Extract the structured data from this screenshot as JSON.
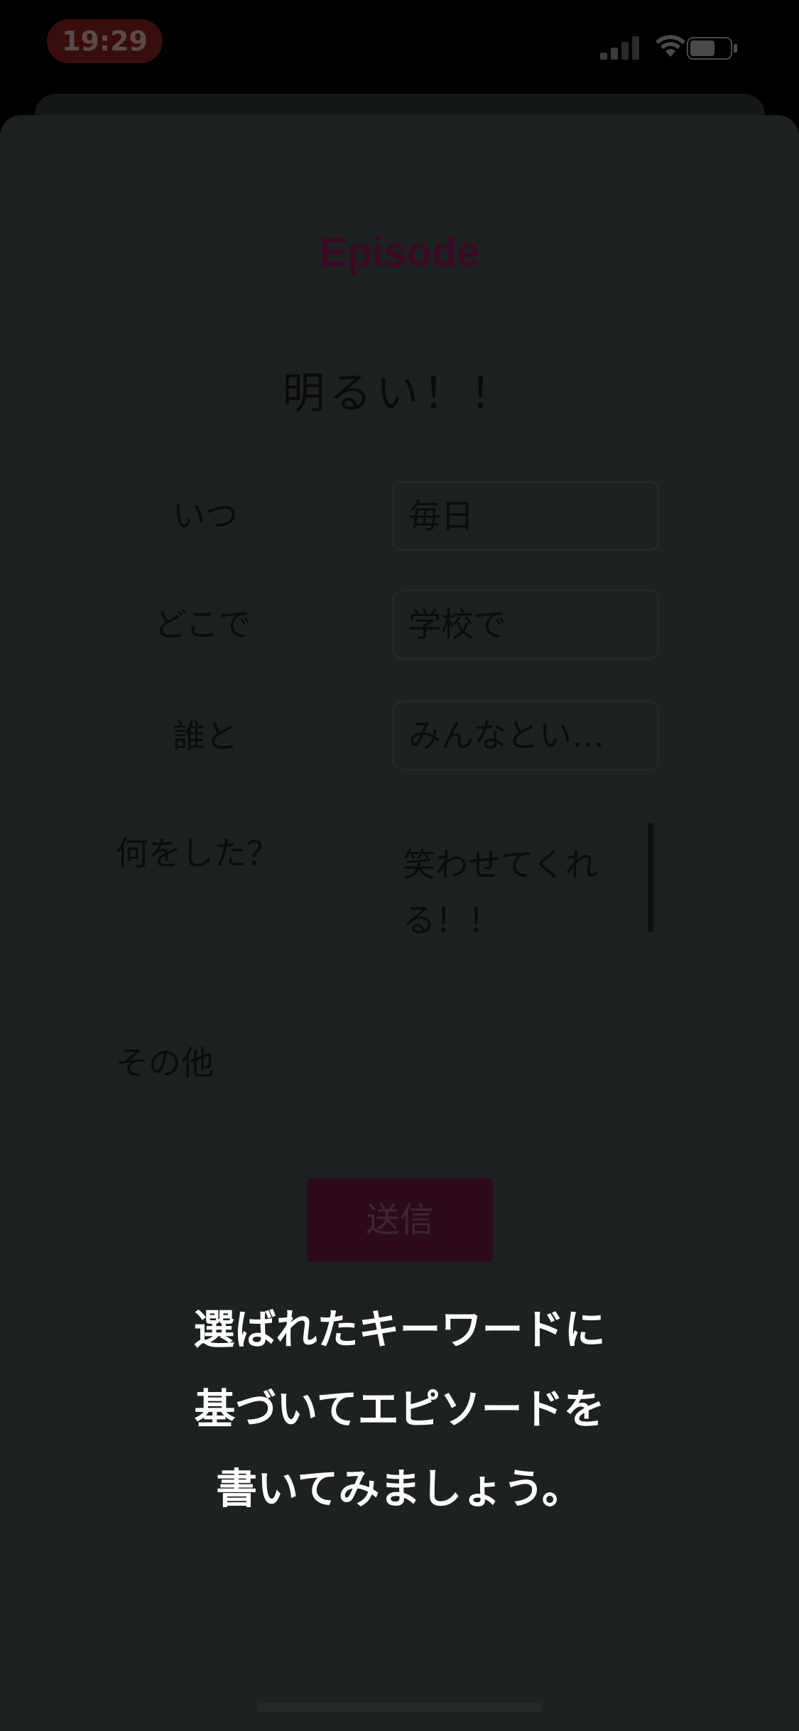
{
  "status_bar": {
    "time": "19:29"
  },
  "header": {
    "title": "Episode"
  },
  "keyword": "明るい！！",
  "form": {
    "when_label": "いつ",
    "when_value": "毎日",
    "where_label": "どこで",
    "where_value": "学校で",
    "with_label": "誰と",
    "with_value": "みんなとい…",
    "what_label": "何をした？",
    "what_value_line1": "笑わせてくれ",
    "what_value_line2": "る！！",
    "other_label": "その他",
    "submit_label": "送信"
  },
  "overlay": {
    "line1": "選ばれたキーワードに",
    "line2": "基づいてエピソードを",
    "line3": "書いてみましょう。"
  },
  "colors": {
    "accent": "#8b1a52",
    "dimmed_background": "#1e2121"
  }
}
